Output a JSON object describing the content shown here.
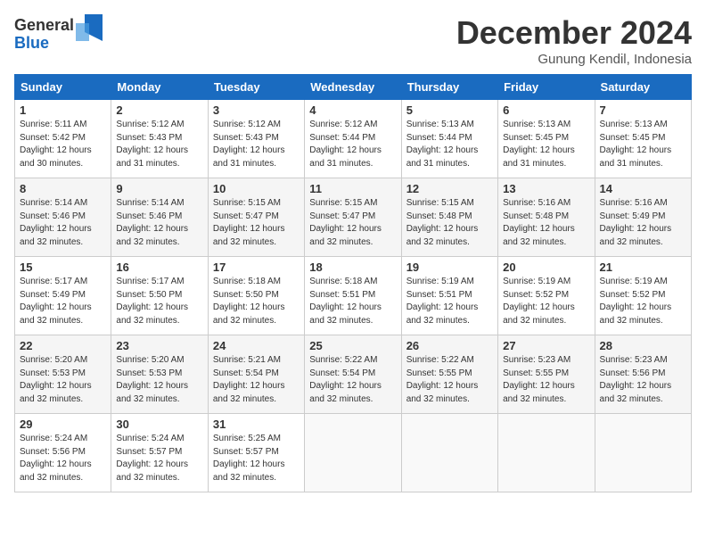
{
  "logo": {
    "general": "General",
    "blue": "Blue"
  },
  "title": "December 2024",
  "location": "Gunung Kendil, Indonesia",
  "days_header": [
    "Sunday",
    "Monday",
    "Tuesday",
    "Wednesday",
    "Thursday",
    "Friday",
    "Saturday"
  ],
  "weeks": [
    [
      {
        "day": "1",
        "info": "Sunrise: 5:11 AM\nSunset: 5:42 PM\nDaylight: 12 hours\nand 30 minutes."
      },
      {
        "day": "2",
        "info": "Sunrise: 5:12 AM\nSunset: 5:43 PM\nDaylight: 12 hours\nand 31 minutes."
      },
      {
        "day": "3",
        "info": "Sunrise: 5:12 AM\nSunset: 5:43 PM\nDaylight: 12 hours\nand 31 minutes."
      },
      {
        "day": "4",
        "info": "Sunrise: 5:12 AM\nSunset: 5:44 PM\nDaylight: 12 hours\nand 31 minutes."
      },
      {
        "day": "5",
        "info": "Sunrise: 5:13 AM\nSunset: 5:44 PM\nDaylight: 12 hours\nand 31 minutes."
      },
      {
        "day": "6",
        "info": "Sunrise: 5:13 AM\nSunset: 5:45 PM\nDaylight: 12 hours\nand 31 minutes."
      },
      {
        "day": "7",
        "info": "Sunrise: 5:13 AM\nSunset: 5:45 PM\nDaylight: 12 hours\nand 31 minutes."
      }
    ],
    [
      {
        "day": "8",
        "info": "Sunrise: 5:14 AM\nSunset: 5:46 PM\nDaylight: 12 hours\nand 32 minutes."
      },
      {
        "day": "9",
        "info": "Sunrise: 5:14 AM\nSunset: 5:46 PM\nDaylight: 12 hours\nand 32 minutes."
      },
      {
        "day": "10",
        "info": "Sunrise: 5:15 AM\nSunset: 5:47 PM\nDaylight: 12 hours\nand 32 minutes."
      },
      {
        "day": "11",
        "info": "Sunrise: 5:15 AM\nSunset: 5:47 PM\nDaylight: 12 hours\nand 32 minutes."
      },
      {
        "day": "12",
        "info": "Sunrise: 5:15 AM\nSunset: 5:48 PM\nDaylight: 12 hours\nand 32 minutes."
      },
      {
        "day": "13",
        "info": "Sunrise: 5:16 AM\nSunset: 5:48 PM\nDaylight: 12 hours\nand 32 minutes."
      },
      {
        "day": "14",
        "info": "Sunrise: 5:16 AM\nSunset: 5:49 PM\nDaylight: 12 hours\nand 32 minutes."
      }
    ],
    [
      {
        "day": "15",
        "info": "Sunrise: 5:17 AM\nSunset: 5:49 PM\nDaylight: 12 hours\nand 32 minutes."
      },
      {
        "day": "16",
        "info": "Sunrise: 5:17 AM\nSunset: 5:50 PM\nDaylight: 12 hours\nand 32 minutes."
      },
      {
        "day": "17",
        "info": "Sunrise: 5:18 AM\nSunset: 5:50 PM\nDaylight: 12 hours\nand 32 minutes."
      },
      {
        "day": "18",
        "info": "Sunrise: 5:18 AM\nSunset: 5:51 PM\nDaylight: 12 hours\nand 32 minutes."
      },
      {
        "day": "19",
        "info": "Sunrise: 5:19 AM\nSunset: 5:51 PM\nDaylight: 12 hours\nand 32 minutes."
      },
      {
        "day": "20",
        "info": "Sunrise: 5:19 AM\nSunset: 5:52 PM\nDaylight: 12 hours\nand 32 minutes."
      },
      {
        "day": "21",
        "info": "Sunrise: 5:19 AM\nSunset: 5:52 PM\nDaylight: 12 hours\nand 32 minutes."
      }
    ],
    [
      {
        "day": "22",
        "info": "Sunrise: 5:20 AM\nSunset: 5:53 PM\nDaylight: 12 hours\nand 32 minutes."
      },
      {
        "day": "23",
        "info": "Sunrise: 5:20 AM\nSunset: 5:53 PM\nDaylight: 12 hours\nand 32 minutes."
      },
      {
        "day": "24",
        "info": "Sunrise: 5:21 AM\nSunset: 5:54 PM\nDaylight: 12 hours\nand 32 minutes."
      },
      {
        "day": "25",
        "info": "Sunrise: 5:22 AM\nSunset: 5:54 PM\nDaylight: 12 hours\nand 32 minutes."
      },
      {
        "day": "26",
        "info": "Sunrise: 5:22 AM\nSunset: 5:55 PM\nDaylight: 12 hours\nand 32 minutes."
      },
      {
        "day": "27",
        "info": "Sunrise: 5:23 AM\nSunset: 5:55 PM\nDaylight: 12 hours\nand 32 minutes."
      },
      {
        "day": "28",
        "info": "Sunrise: 5:23 AM\nSunset: 5:56 PM\nDaylight: 12 hours\nand 32 minutes."
      }
    ],
    [
      {
        "day": "29",
        "info": "Sunrise: 5:24 AM\nSunset: 5:56 PM\nDaylight: 12 hours\nand 32 minutes."
      },
      {
        "day": "30",
        "info": "Sunrise: 5:24 AM\nSunset: 5:57 PM\nDaylight: 12 hours\nand 32 minutes."
      },
      {
        "day": "31",
        "info": "Sunrise: 5:25 AM\nSunset: 5:57 PM\nDaylight: 12 hours\nand 32 minutes."
      },
      {
        "day": "",
        "info": ""
      },
      {
        "day": "",
        "info": ""
      },
      {
        "day": "",
        "info": ""
      },
      {
        "day": "",
        "info": ""
      }
    ]
  ]
}
